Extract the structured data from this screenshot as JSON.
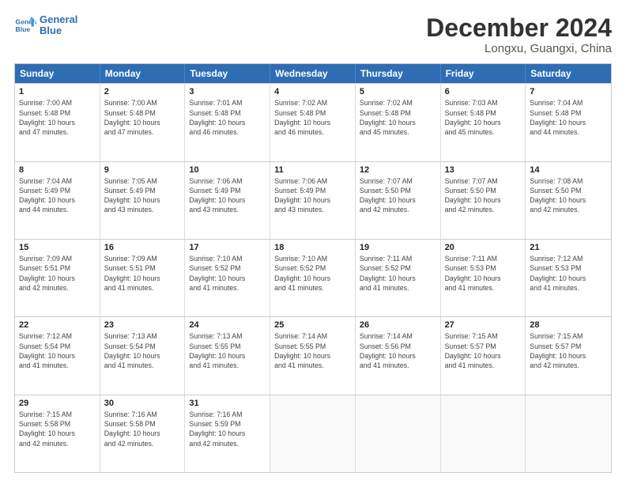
{
  "header": {
    "logo_line1": "General",
    "logo_line2": "Blue",
    "title": "December 2024",
    "subtitle": "Longxu, Guangxi, China"
  },
  "weekdays": [
    "Sunday",
    "Monday",
    "Tuesday",
    "Wednesday",
    "Thursday",
    "Friday",
    "Saturday"
  ],
  "rows": [
    [
      {
        "date": "1",
        "info": "Sunrise: 7:00 AM\nSunset: 5:48 PM\nDaylight: 10 hours\nand 47 minutes."
      },
      {
        "date": "2",
        "info": "Sunrise: 7:00 AM\nSunset: 5:48 PM\nDaylight: 10 hours\nand 47 minutes."
      },
      {
        "date": "3",
        "info": "Sunrise: 7:01 AM\nSunset: 5:48 PM\nDaylight: 10 hours\nand 46 minutes."
      },
      {
        "date": "4",
        "info": "Sunrise: 7:02 AM\nSunset: 5:48 PM\nDaylight: 10 hours\nand 46 minutes."
      },
      {
        "date": "5",
        "info": "Sunrise: 7:02 AM\nSunset: 5:48 PM\nDaylight: 10 hours\nand 45 minutes."
      },
      {
        "date": "6",
        "info": "Sunrise: 7:03 AM\nSunset: 5:48 PM\nDaylight: 10 hours\nand 45 minutes."
      },
      {
        "date": "7",
        "info": "Sunrise: 7:04 AM\nSunset: 5:48 PM\nDaylight: 10 hours\nand 44 minutes."
      }
    ],
    [
      {
        "date": "8",
        "info": "Sunrise: 7:04 AM\nSunset: 5:49 PM\nDaylight: 10 hours\nand 44 minutes."
      },
      {
        "date": "9",
        "info": "Sunrise: 7:05 AM\nSunset: 5:49 PM\nDaylight: 10 hours\nand 43 minutes."
      },
      {
        "date": "10",
        "info": "Sunrise: 7:06 AM\nSunset: 5:49 PM\nDaylight: 10 hours\nand 43 minutes."
      },
      {
        "date": "11",
        "info": "Sunrise: 7:06 AM\nSunset: 5:49 PM\nDaylight: 10 hours\nand 43 minutes."
      },
      {
        "date": "12",
        "info": "Sunrise: 7:07 AM\nSunset: 5:50 PM\nDaylight: 10 hours\nand 42 minutes."
      },
      {
        "date": "13",
        "info": "Sunrise: 7:07 AM\nSunset: 5:50 PM\nDaylight: 10 hours\nand 42 minutes."
      },
      {
        "date": "14",
        "info": "Sunrise: 7:08 AM\nSunset: 5:50 PM\nDaylight: 10 hours\nand 42 minutes."
      }
    ],
    [
      {
        "date": "15",
        "info": "Sunrise: 7:09 AM\nSunset: 5:51 PM\nDaylight: 10 hours\nand 42 minutes."
      },
      {
        "date": "16",
        "info": "Sunrise: 7:09 AM\nSunset: 5:51 PM\nDaylight: 10 hours\nand 41 minutes."
      },
      {
        "date": "17",
        "info": "Sunrise: 7:10 AM\nSunset: 5:52 PM\nDaylight: 10 hours\nand 41 minutes."
      },
      {
        "date": "18",
        "info": "Sunrise: 7:10 AM\nSunset: 5:52 PM\nDaylight: 10 hours\nand 41 minutes."
      },
      {
        "date": "19",
        "info": "Sunrise: 7:11 AM\nSunset: 5:52 PM\nDaylight: 10 hours\nand 41 minutes."
      },
      {
        "date": "20",
        "info": "Sunrise: 7:11 AM\nSunset: 5:53 PM\nDaylight: 10 hours\nand 41 minutes."
      },
      {
        "date": "21",
        "info": "Sunrise: 7:12 AM\nSunset: 5:53 PM\nDaylight: 10 hours\nand 41 minutes."
      }
    ],
    [
      {
        "date": "22",
        "info": "Sunrise: 7:12 AM\nSunset: 5:54 PM\nDaylight: 10 hours\nand 41 minutes."
      },
      {
        "date": "23",
        "info": "Sunrise: 7:13 AM\nSunset: 5:54 PM\nDaylight: 10 hours\nand 41 minutes."
      },
      {
        "date": "24",
        "info": "Sunrise: 7:13 AM\nSunset: 5:55 PM\nDaylight: 10 hours\nand 41 minutes."
      },
      {
        "date": "25",
        "info": "Sunrise: 7:14 AM\nSunset: 5:55 PM\nDaylight: 10 hours\nand 41 minutes."
      },
      {
        "date": "26",
        "info": "Sunrise: 7:14 AM\nSunset: 5:56 PM\nDaylight: 10 hours\nand 41 minutes."
      },
      {
        "date": "27",
        "info": "Sunrise: 7:15 AM\nSunset: 5:57 PM\nDaylight: 10 hours\nand 41 minutes."
      },
      {
        "date": "28",
        "info": "Sunrise: 7:15 AM\nSunset: 5:57 PM\nDaylight: 10 hours\nand 42 minutes."
      }
    ],
    [
      {
        "date": "29",
        "info": "Sunrise: 7:15 AM\nSunset: 5:58 PM\nDaylight: 10 hours\nand 42 minutes."
      },
      {
        "date": "30",
        "info": "Sunrise: 7:16 AM\nSunset: 5:58 PM\nDaylight: 10 hours\nand 42 minutes."
      },
      {
        "date": "31",
        "info": "Sunrise: 7:16 AM\nSunset: 5:59 PM\nDaylight: 10 hours\nand 42 minutes."
      },
      {
        "date": "",
        "info": ""
      },
      {
        "date": "",
        "info": ""
      },
      {
        "date": "",
        "info": ""
      },
      {
        "date": "",
        "info": ""
      }
    ]
  ]
}
